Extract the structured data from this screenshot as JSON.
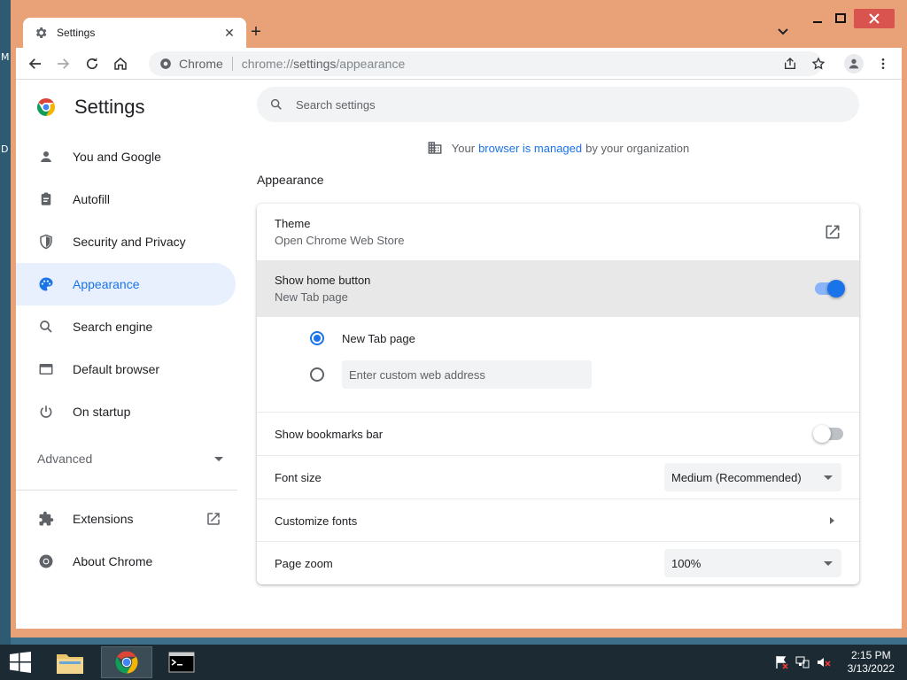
{
  "desktop": {
    "glyph_top": "M",
    "glyph_mid": "D"
  },
  "browser": {
    "tab_title": "Settings",
    "tab_close": "✕",
    "new_tab": "+",
    "omnibox": {
      "site_label": "Chrome",
      "url_host": "chrome://",
      "url_settings": "settings",
      "url_path": "/appearance"
    }
  },
  "settings": {
    "title": "Settings",
    "nav": [
      {
        "label": "You and Google",
        "icon": "person-icon"
      },
      {
        "label": "Autofill",
        "icon": "clipboard-icon"
      },
      {
        "label": "Security and Privacy",
        "icon": "shield-icon"
      },
      {
        "label": "Appearance",
        "icon": "palette-icon",
        "active": true
      },
      {
        "label": "Search engine",
        "icon": "magnifier-icon"
      },
      {
        "label": "Default browser",
        "icon": "browser-window-icon"
      },
      {
        "label": "On startup",
        "icon": "power-icon"
      }
    ],
    "advanced_label": "Advanced",
    "extensions_label": "Extensions",
    "about_label": "About Chrome",
    "search_placeholder": "Search settings",
    "managed": {
      "prefix": "Your",
      "link": "browser is managed",
      "suffix": "by your organization"
    },
    "section_title": "Appearance",
    "theme": {
      "label": "Theme",
      "sub": "Open Chrome Web Store"
    },
    "home_button": {
      "label": "Show home button",
      "sub": "New Tab page",
      "enabled": true
    },
    "home_options": {
      "new_tab_label": "New Tab page",
      "custom_placeholder": "Enter custom web address",
      "selected": "new_tab"
    },
    "bookmarks_bar": {
      "label": "Show bookmarks bar",
      "enabled": false
    },
    "font_size": {
      "label": "Font size",
      "value": "Medium (Recommended)"
    },
    "customize_fonts": {
      "label": "Customize fonts"
    },
    "page_zoom": {
      "label": "Page zoom",
      "value": "100%"
    }
  },
  "taskbar": {
    "time": "2:15 PM",
    "date": "3/13/2022"
  },
  "colors": {
    "accent": "#1a73e8",
    "titlebar": "#e9a277",
    "taskbar": "#1b2a33",
    "active_nav_bg": "#e8f0fe"
  }
}
